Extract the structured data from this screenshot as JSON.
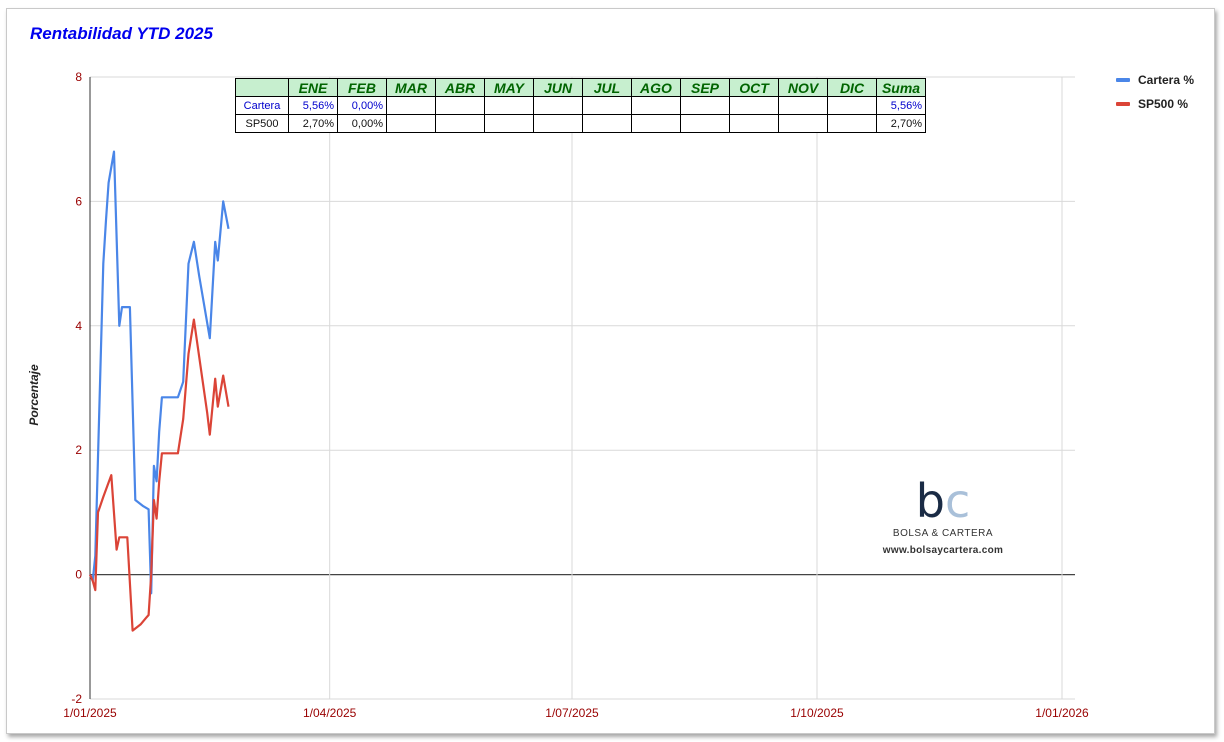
{
  "chart_data": {
    "type": "line",
    "title": "Rentabilidad YTD 2025",
    "xlabel": "",
    "ylabel": "Porcentaje",
    "xlim": [
      "2025-01-01",
      "2026-01-01"
    ],
    "ylim": [
      -2,
      8
    ],
    "yticks": [
      "-2",
      "0",
      "2",
      "4",
      "6",
      "8"
    ],
    "xticks": [
      {
        "date": "2025-01-01",
        "label": "1/01/2025"
      },
      {
        "date": "2025-04-01",
        "label": "1/04/2025"
      },
      {
        "date": "2025-07-01",
        "label": "1/07/2025"
      },
      {
        "date": "2025-10-01",
        "label": "1/10/2025"
      },
      {
        "date": "2026-01-01",
        "label": "1/01/2026"
      }
    ],
    "grid": true,
    "legend_position": "right",
    "series": [
      {
        "name": "Cartera %",
        "color": "#4a86e8",
        "points": [
          [
            "2025-01-01",
            0.0
          ],
          [
            "2025-01-02",
            -0.1
          ],
          [
            "2025-01-03",
            0.3
          ],
          [
            "2025-01-06",
            5.0
          ],
          [
            "2025-01-07",
            5.7
          ],
          [
            "2025-01-08",
            6.3
          ],
          [
            "2025-01-10",
            6.8
          ],
          [
            "2025-01-12",
            4.0
          ],
          [
            "2025-01-13",
            4.3
          ],
          [
            "2025-01-14",
            4.3
          ],
          [
            "2025-01-16",
            4.3
          ],
          [
            "2025-01-18",
            1.2
          ],
          [
            "2025-01-21",
            1.1
          ],
          [
            "2025-01-23",
            1.05
          ],
          [
            "2025-01-24",
            -0.3
          ],
          [
            "2025-01-25",
            1.75
          ],
          [
            "2025-01-26",
            1.5
          ],
          [
            "2025-01-27",
            2.3
          ],
          [
            "2025-01-28",
            2.85
          ],
          [
            "2025-02-03",
            2.85
          ],
          [
            "2025-02-05",
            3.1
          ],
          [
            "2025-02-07",
            5.0
          ],
          [
            "2025-02-09",
            5.35
          ],
          [
            "2025-02-11",
            4.8
          ],
          [
            "2025-02-15",
            3.8
          ],
          [
            "2025-02-17",
            5.35
          ],
          [
            "2025-02-18",
            5.05
          ],
          [
            "2025-02-20",
            6.0
          ],
          [
            "2025-02-22",
            5.56
          ]
        ]
      },
      {
        "name": "SP500 %",
        "color": "#db4437",
        "points": [
          [
            "2025-01-01",
            0.0
          ],
          [
            "2025-01-02",
            -0.1
          ],
          [
            "2025-01-03",
            -0.25
          ],
          [
            "2025-01-04",
            1.0
          ],
          [
            "2025-01-06",
            1.25
          ],
          [
            "2025-01-09",
            1.6
          ],
          [
            "2025-01-11",
            0.4
          ],
          [
            "2025-01-12",
            0.6
          ],
          [
            "2025-01-15",
            0.6
          ],
          [
            "2025-01-17",
            -0.9
          ],
          [
            "2025-01-20",
            -0.8
          ],
          [
            "2025-01-22",
            -0.7
          ],
          [
            "2025-01-23",
            -0.65
          ],
          [
            "2025-01-24",
            0.0
          ],
          [
            "2025-01-25",
            1.2
          ],
          [
            "2025-01-26",
            0.9
          ],
          [
            "2025-01-27",
            1.5
          ],
          [
            "2025-01-28",
            1.95
          ],
          [
            "2025-02-03",
            1.95
          ],
          [
            "2025-02-05",
            2.5
          ],
          [
            "2025-02-07",
            3.55
          ],
          [
            "2025-02-09",
            4.1
          ],
          [
            "2025-02-11",
            3.5
          ],
          [
            "2025-02-14",
            2.6
          ],
          [
            "2025-02-15",
            2.25
          ],
          [
            "2025-02-17",
            3.15
          ],
          [
            "2025-02-18",
            2.7
          ],
          [
            "2025-02-20",
            3.2
          ],
          [
            "2025-02-22",
            2.7
          ]
        ]
      }
    ]
  },
  "table": {
    "months": [
      "ENE",
      "FEB",
      "MAR",
      "ABR",
      "MAY",
      "JUN",
      "JUL",
      "AGO",
      "SEP",
      "OCT",
      "NOV",
      "DIC",
      "Suma"
    ],
    "rows": [
      {
        "label": "Cartera",
        "values": [
          "5,56%",
          "0,00%",
          "",
          "",
          "",
          "",
          "",
          "",
          "",
          "",
          "",
          "",
          "5,56%"
        ]
      },
      {
        "label": "SP500",
        "values": [
          "2,70%",
          "0,00%",
          "",
          "",
          "",
          "",
          "",
          "",
          "",
          "",
          "",
          "",
          "2,70%"
        ]
      }
    ]
  },
  "watermark": {
    "mark_b": "b",
    "mark_c": "c",
    "name": "BOLSA & CARTERA",
    "url": "www.bolsaycartera.com"
  },
  "colors": {
    "title": "#0000ee",
    "axis_labels": "#990000",
    "table_header_bg": "#c7efcf",
    "table_header_text": "#006400"
  }
}
